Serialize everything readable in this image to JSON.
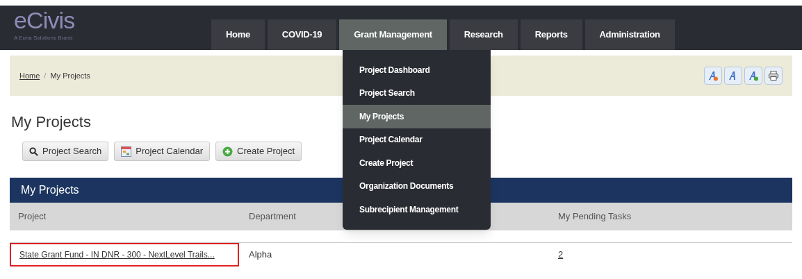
{
  "logo": {
    "name": "eCivis",
    "tagline": "A Euna Solutions Brand"
  },
  "nav": [
    {
      "label": "Home",
      "selected": false
    },
    {
      "label": "COVID-19",
      "selected": false
    },
    {
      "label": "Grant Management",
      "selected": true
    },
    {
      "label": "Research",
      "selected": false
    },
    {
      "label": "Reports",
      "selected": false
    },
    {
      "label": "Administration",
      "selected": false
    }
  ],
  "dropdown": [
    {
      "label": "Project Dashboard",
      "selected": false
    },
    {
      "label": "Project Search",
      "selected": false
    },
    {
      "label": "My Projects",
      "selected": true
    },
    {
      "label": "Project Calendar",
      "selected": false
    },
    {
      "label": "Create Project",
      "selected": false
    },
    {
      "label": "Organization Documents",
      "selected": false
    },
    {
      "label": "Subrecipient Management",
      "selected": false
    }
  ],
  "breadcrumb": [
    {
      "label": "Home",
      "kind": "link"
    },
    {
      "label": "My Projects",
      "kind": "current"
    }
  ],
  "breadcrumb_separator": "/",
  "tools": [
    {
      "kind": "font-decrease"
    },
    {
      "kind": "font-normal"
    },
    {
      "kind": "font-increase"
    },
    {
      "kind": "print"
    }
  ],
  "page_title": "My Projects",
  "actions": [
    {
      "label": "Project Search",
      "kind": "search"
    },
    {
      "label": "Project Calendar",
      "kind": "calendar"
    },
    {
      "label": "Create Project",
      "kind": "create"
    }
  ],
  "table": {
    "title": "My Projects",
    "columns": [
      "Project",
      "Department",
      "My Pending Tasks"
    ],
    "rows": [
      {
        "project": "State Grant Fund - IN DNR - 300 - NextLevel Trails...",
        "highlighted": true,
        "department": "Alpha",
        "tasks": "2"
      }
    ]
  }
}
